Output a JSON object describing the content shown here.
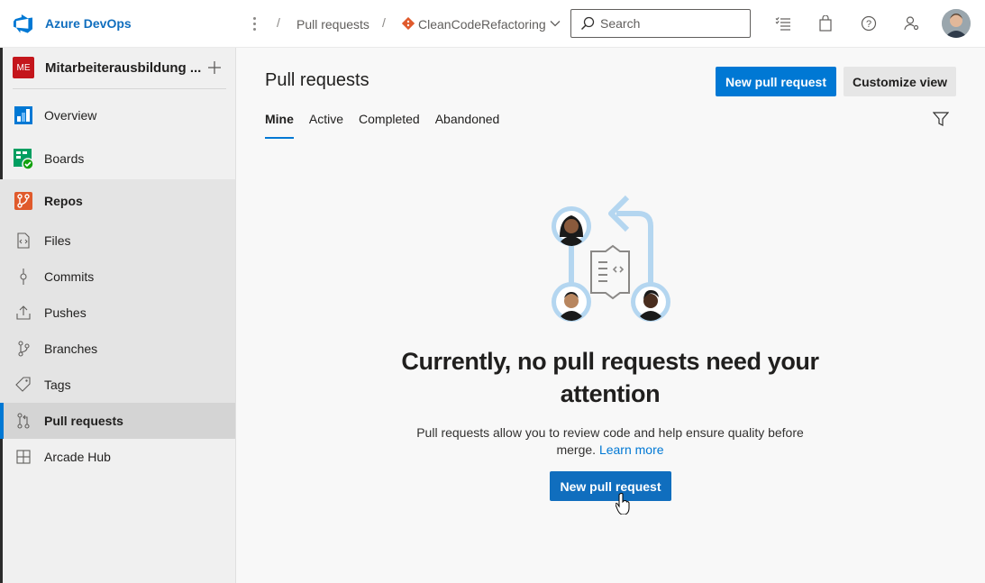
{
  "brand": {
    "name": "Azure DevOps"
  },
  "breadcrumbs": [
    {
      "label": "Pull requests"
    },
    {
      "label": "CleanCodeRefactoring",
      "icon": "git-repo-icon"
    }
  ],
  "search": {
    "placeholder": "Search"
  },
  "toolbar_icons": [
    "task-list-icon",
    "shopping-bag-icon",
    "help-icon",
    "user-settings-icon"
  ],
  "project": {
    "initials": "ME",
    "name": "Mitarbeiterausbildung ...",
    "badge_color": "#c4161c"
  },
  "sidebar": {
    "items": [
      {
        "label": "Overview",
        "icon": "overview-icon"
      },
      {
        "label": "Boards",
        "icon": "boards-icon"
      },
      {
        "label": "Repos",
        "icon": "repos-icon"
      },
      {
        "label": "Files",
        "icon": "files-icon"
      },
      {
        "label": "Commits",
        "icon": "commits-icon"
      },
      {
        "label": "Pushes",
        "icon": "pushes-icon"
      },
      {
        "label": "Branches",
        "icon": "branches-icon"
      },
      {
        "label": "Tags",
        "icon": "tags-icon"
      },
      {
        "label": "Pull requests",
        "icon": "pull-request-icon",
        "active": true
      },
      {
        "label": "Arcade Hub",
        "icon": "grid-icon"
      }
    ]
  },
  "main": {
    "title": "Pull requests",
    "new_pr_label": "New pull request",
    "customize_label": "Customize view",
    "tabs": [
      {
        "label": "Mine",
        "selected": true
      },
      {
        "label": "Active"
      },
      {
        "label": "Completed"
      },
      {
        "label": "Abandoned"
      }
    ],
    "empty": {
      "title": "Currently, no pull requests need your attention",
      "description": "Pull requests allow you to review code and help ensure quality before merge.",
      "link": "Learn more",
      "button": "New pull request"
    }
  },
  "colors": {
    "accent": "#0078d4",
    "brand": "#106ebe"
  }
}
